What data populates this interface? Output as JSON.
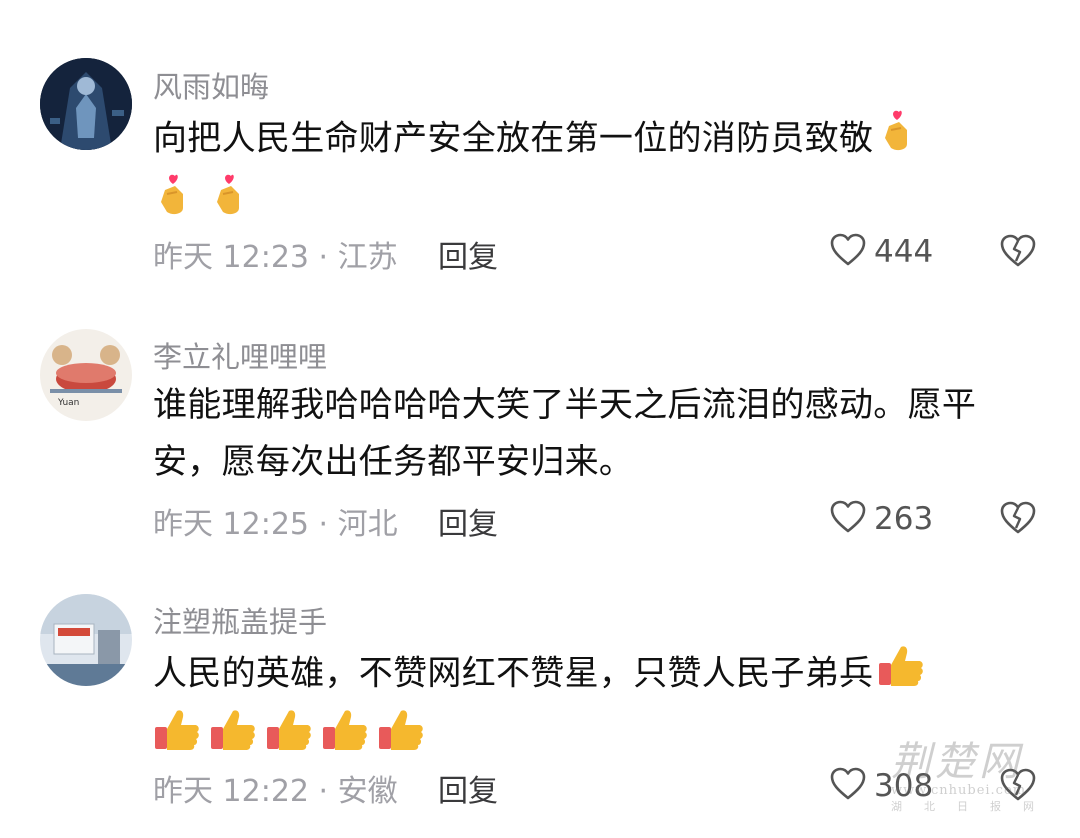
{
  "comments": [
    {
      "username": "风雨如晦",
      "text": "向把人民生命财产安全放在第一位的消防员致敬",
      "emojis_inline": [
        "finger-heart-icon"
      ],
      "emojis_next_line": [
        "finger-heart-icon",
        "finger-heart-icon"
      ],
      "time_location": "昨天 12:23 · 江苏",
      "reply_label": "回复",
      "likes": "444"
    },
    {
      "username": "李立礼哩哩哩",
      "text": "谁能理解我哈哈哈哈大笑了半天之后流泪的感动。愿平安，愿每次出任务都平安归来。",
      "time_location": "昨天 12:25 · 河北",
      "reply_label": "回复",
      "likes": "263"
    },
    {
      "username": "注塑瓶盖提手",
      "text": "人民的英雄，不赞网红不赞星，只赞人民子弟兵",
      "emojis_inline": [
        "thumbs-up-icon"
      ],
      "emojis_next_line": [
        "thumbs-up-icon",
        "thumbs-up-icon",
        "thumbs-up-icon",
        "thumbs-up-icon",
        "thumbs-up-icon"
      ],
      "time_location": "昨天 12:22 · 安徽",
      "reply_label": "回复",
      "likes": "308"
    }
  ],
  "watermark": {
    "logo_text": "荆楚网",
    "url": "www.cnhubei.com",
    "tagline": "湖北日报网"
  },
  "colors": {
    "username": "#8e8e93",
    "comment_text": "#111111",
    "meta": "#a0a0a6",
    "heart_emoji": "#f2b53a",
    "thumbs_emoji": "#f5b82e"
  }
}
